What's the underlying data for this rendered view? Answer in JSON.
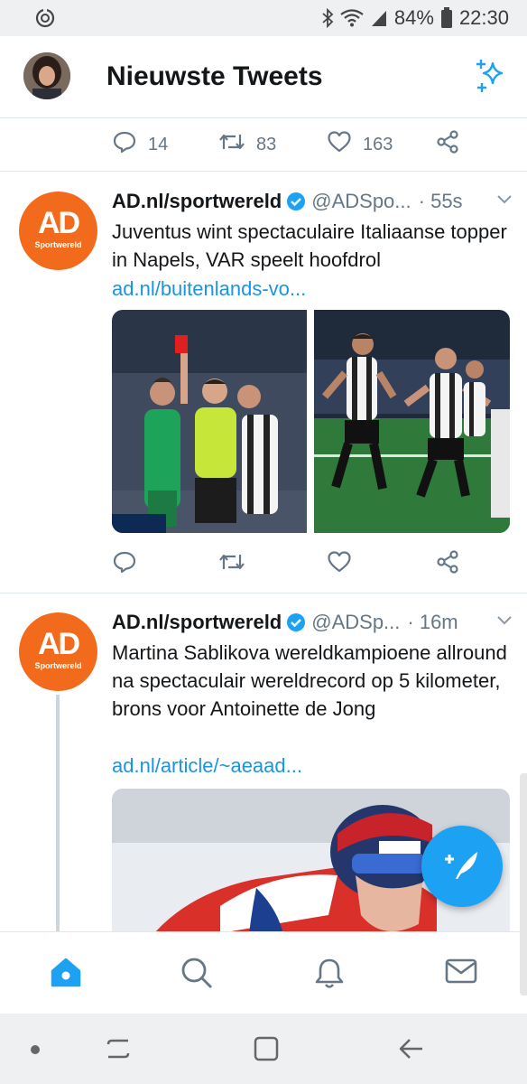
{
  "status_bar": {
    "battery": "84%",
    "time": "22:30"
  },
  "header": {
    "title": "Nieuwste Tweets"
  },
  "prev_tweet_actions": {
    "replies": "14",
    "retweets": "83",
    "likes": "163"
  },
  "tweets": [
    {
      "name": "AD.nl/sportwereld",
      "handle": "@ADSpo...",
      "time": "· 55s",
      "text": "Juventus wint spectaculaire Italiaanse topper in Napels, VAR speelt hoofdrol",
      "link": "ad.nl/buitenlands-vo...",
      "avatar_text": "AD",
      "avatar_sub": "Sportwereld"
    },
    {
      "name": "AD.nl/sportwereld",
      "handle": "@ADSp...",
      "time": "· 16m",
      "text": "Martina Sablikova wereldkampioene allround na spectaculair wereldrecord op 5 kilometer, brons voor Antoinette de Jong",
      "link": "ad.nl/article/~aeaad...",
      "avatar_text": "AD",
      "avatar_sub": "Sportwereld"
    }
  ],
  "colors": {
    "accent": "#1da1f2",
    "link": "#1b95e0",
    "ad_orange": "#f26b1d"
  },
  "icons": [
    "reply-icon",
    "retweet-icon",
    "like-icon",
    "share-icon",
    "verified-icon",
    "home-icon",
    "search-icon",
    "notifications-icon",
    "messages-icon",
    "compose-icon",
    "sparkle-icon"
  ]
}
